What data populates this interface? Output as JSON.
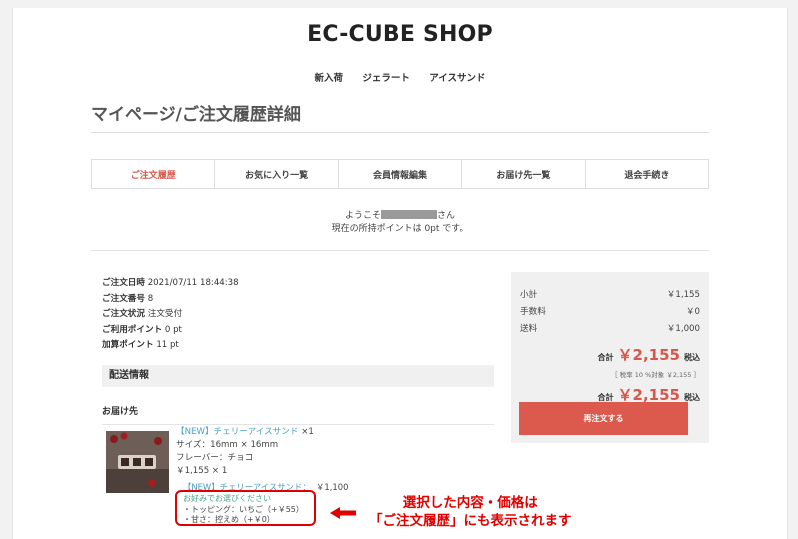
{
  "header": {
    "shop_name": "EC-CUBE SHOP"
  },
  "nav": [
    "新入荷",
    "ジェラート",
    "アイスサンド"
  ],
  "page_title": "マイページ/ご注文履歴詳細",
  "tabs": [
    "ご注文履歴",
    "お気に入り一覧",
    "会員情報編集",
    "お届け先一覧",
    "退会手続き"
  ],
  "welcome": {
    "prefix": "ようこそ",
    "suffix": "さん",
    "points": "現在の所持ポイントは 0pt です。"
  },
  "order": {
    "date_label": "ご注文日時",
    "date": "2021/07/11 18:44:38",
    "number_label": "ご注文番号",
    "number": "8",
    "status_label": "ご注文状況",
    "status": "注文受付",
    "used_points_label": "ご利用ポイント",
    "used_points": "0 pt",
    "added_points_label": "加算ポイント",
    "added_points": "11 pt"
  },
  "shipping": {
    "section_title": "配送情報",
    "destination_label": "お届け先"
  },
  "item": {
    "name": "【NEW】チェリーアイスサンド",
    "qty": "×1",
    "size": "サイズ：16mm × 16mm",
    "flavor": "フレーバー：チョコ",
    "price_line": "￥1,155 × 1",
    "option_name": "【NEW】チェリーアイスサンド：",
    "option_price": "￥1,100",
    "option_head": "お好みでお選びください",
    "option_1": "・トッピング：いちご（+￥55）",
    "option_2": "・甘さ：控えめ（+￥0）"
  },
  "annotation": {
    "line1": "選択した内容・価格は",
    "line2": "「ご注文履歴」にも表示されます"
  },
  "summary": {
    "subtotal_label": "小計",
    "subtotal": "￥1,155",
    "fee_label": "手数料",
    "fee": "￥0",
    "shipping_label": "送料",
    "shipping": "￥1,000",
    "total_label": "合計",
    "total": "￥2,155",
    "tax_incl": "税込",
    "tax_note": "［ 税率 10 %対象 ￥2,155 ］",
    "total2_label": "合計",
    "total2": "￥2,155",
    "tax_incl2": "税込",
    "reorder_label": "再注文する"
  }
}
